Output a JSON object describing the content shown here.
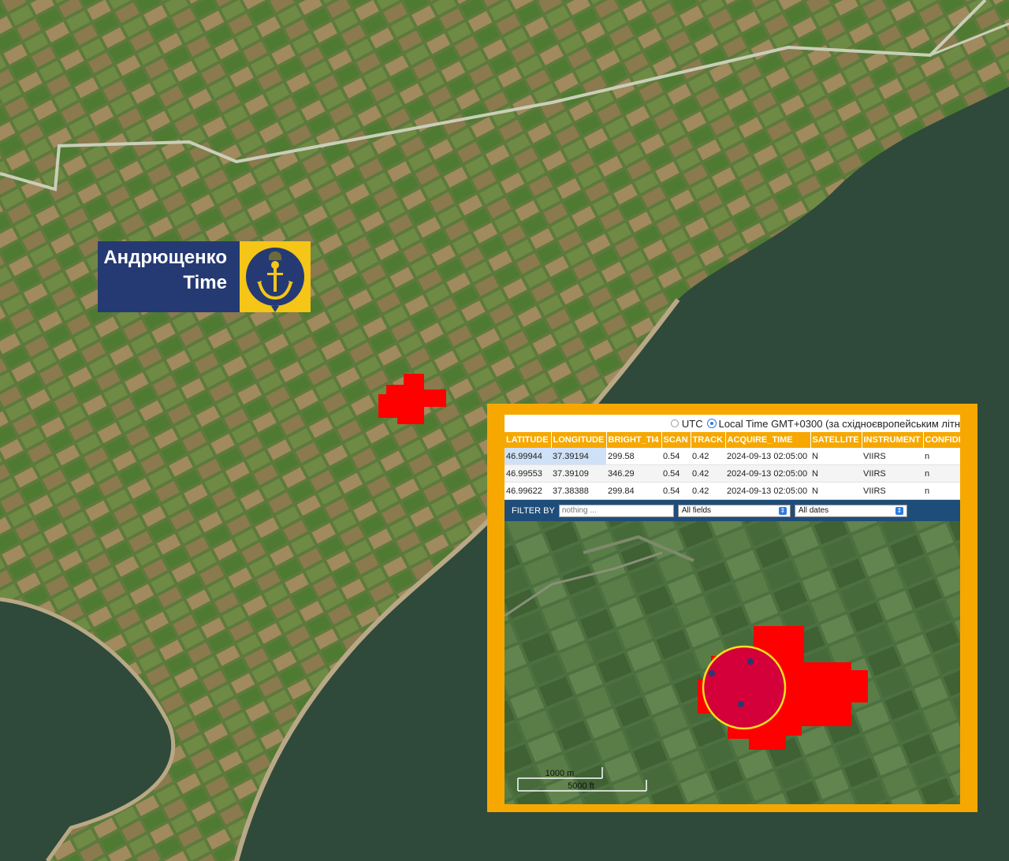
{
  "brand": {
    "line1": "Андрющенко",
    "line2": "Time"
  },
  "inset": {
    "time_options": {
      "utc": "UTC",
      "local": "Local Time GMT+0300 (за східноєвропейським літн"
    },
    "columns": [
      "LATITUDE",
      "LONGITUDE",
      "BRIGHT_TI4",
      "SCAN",
      "TRACK",
      "ACQUIRE_TIME",
      "SATELLITE",
      "INSTRUMENT",
      "CONFIDE"
    ],
    "rows": [
      [
        "46.99944",
        "37.39194",
        "299.58",
        "0.54",
        "0.42",
        "2024-09-13 02:05:00",
        "N",
        "VIIRS",
        "n"
      ],
      [
        "46.99553",
        "37.39109",
        "346.29",
        "0.54",
        "0.42",
        "2024-09-13 02:05:00",
        "N",
        "VIIRS",
        "n"
      ],
      [
        "46.99622",
        "37.38388",
        "299.84",
        "0.54",
        "0.42",
        "2024-09-13 02:05:00",
        "N",
        "VIIRS",
        "n"
      ]
    ],
    "filter": {
      "label": "FILTER BY",
      "placeholder": "nothing ...",
      "fields": "All fields",
      "dates": "All dates"
    },
    "scale": {
      "metric": "1000 m",
      "imperial": "5000 ft"
    }
  },
  "colors": {
    "fire": "#ff0000",
    "inset_border": "#f6a800",
    "brand_blue": "#253a73",
    "brand_yellow": "#f5c518",
    "sea": "#2f4a3a"
  },
  "icons": {
    "logo": "anchor-helmet-icon"
  }
}
